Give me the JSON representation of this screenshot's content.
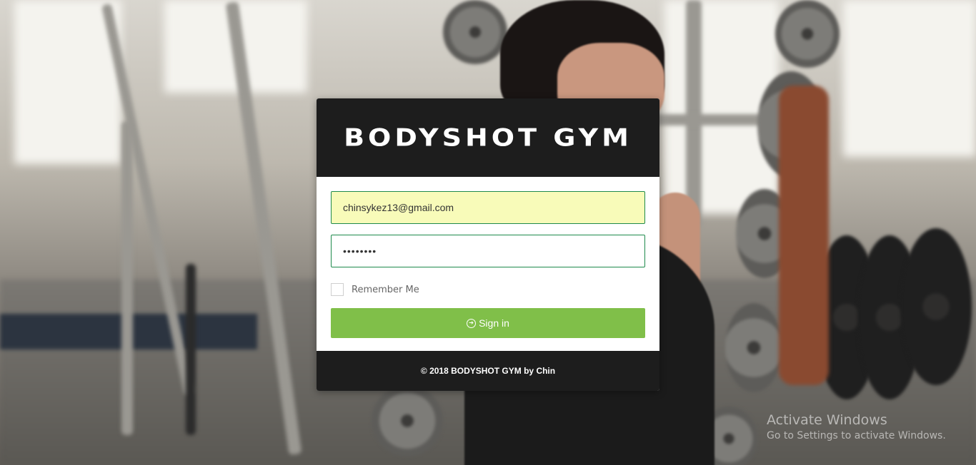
{
  "brand": {
    "title": "BODYSHOT GYM"
  },
  "login": {
    "email_value": "chinsykez13@gmail.com",
    "password_value": "pass1234",
    "remember_label": "Remember Me",
    "signin_label": "Sign in",
    "signin_icon": "sign-in-icon"
  },
  "footer": {
    "copyright": "© 2018 BODYSHOT GYM by Chin"
  },
  "watermark": {
    "title": "Activate Windows",
    "subtitle": "Go to Settings to activate Windows."
  },
  "colors": {
    "header_bg": "#1d1d1d",
    "email_autofill_bg": "#f8fbb9",
    "input_border": "#1e8a4c",
    "signin_button": "#80bf49"
  }
}
